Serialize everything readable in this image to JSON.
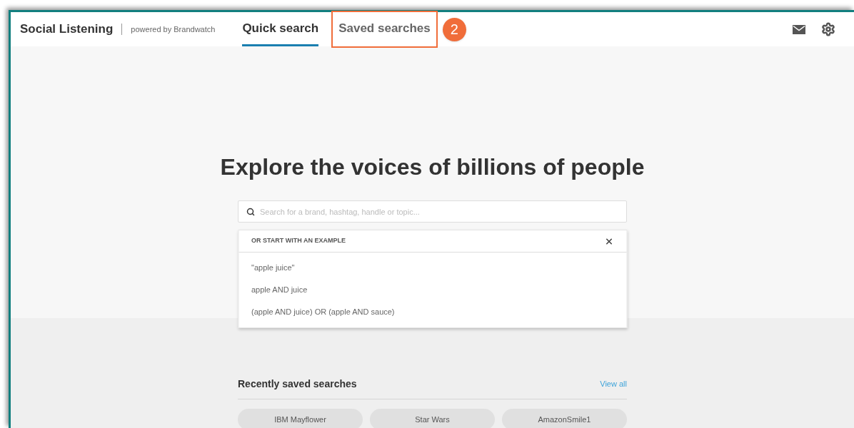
{
  "header": {
    "app_title": "Social Listening",
    "powered_by": "powered by Brandwatch",
    "tabs": [
      {
        "label": "Quick search",
        "selected": true,
        "highlighted": false
      },
      {
        "label": "Saved searches",
        "selected": false,
        "highlighted": true
      }
    ],
    "callout_number": "2"
  },
  "hero": {
    "heading": "Explore the voices of billions of people",
    "search": {
      "placeholder": "Search for a brand, hashtag, handle or topic..."
    },
    "examples": {
      "title": "OR START WITH AN EXAMPLE",
      "items": [
        "\"apple juice\"",
        "apple AND juice",
        "(apple AND juice) OR (apple AND sauce)"
      ]
    }
  },
  "recent": {
    "title": "Recently saved searches",
    "view_all": "View all",
    "items": [
      "IBM Mayflower",
      "Star Wars",
      "AmazonSmile1"
    ]
  }
}
